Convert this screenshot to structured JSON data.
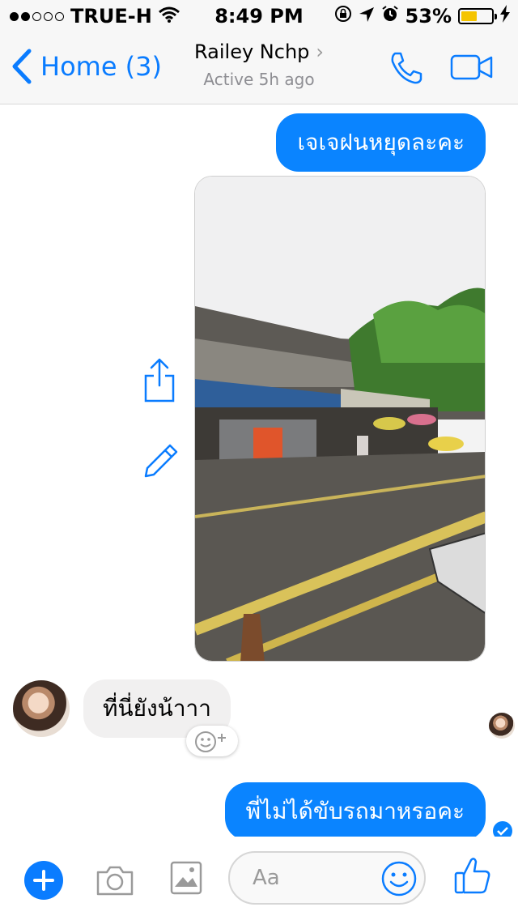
{
  "status": {
    "carrier": "TRUE-H",
    "time": "8:49 PM",
    "battery": "53%",
    "battery_level": 0.53,
    "signal_bars": 2
  },
  "nav": {
    "back_label": "Home (3)",
    "contact_name": "Railey Nchp",
    "contact_status": "Active 5h ago"
  },
  "messages": [
    {
      "from": "me",
      "text": "เจเจฝนหยุดละคะ"
    },
    {
      "from": "me",
      "type": "photo"
    },
    {
      "from": "them",
      "text": "ที่นี่ยังน้าาา"
    },
    {
      "from": "me",
      "text": "พี่ไม่ได้ขับรถมาหรอคะ"
    }
  ],
  "composer": {
    "placeholder": "Aa"
  },
  "colors": {
    "accent": "#0a84ff",
    "incoming_bubble": "#f1f0f0",
    "battery_fill": "#f5c400"
  },
  "icons": [
    "wifi-icon",
    "lock-rotation-icon",
    "location-icon",
    "alarm-icon",
    "charging-icon",
    "back-chevron-icon",
    "phone-icon",
    "video-icon",
    "share-icon",
    "edit-icon",
    "add-reaction-icon",
    "plus-icon",
    "camera-icon",
    "gallery-icon",
    "emoji-icon",
    "like-icon",
    "seen-check-icon"
  ]
}
